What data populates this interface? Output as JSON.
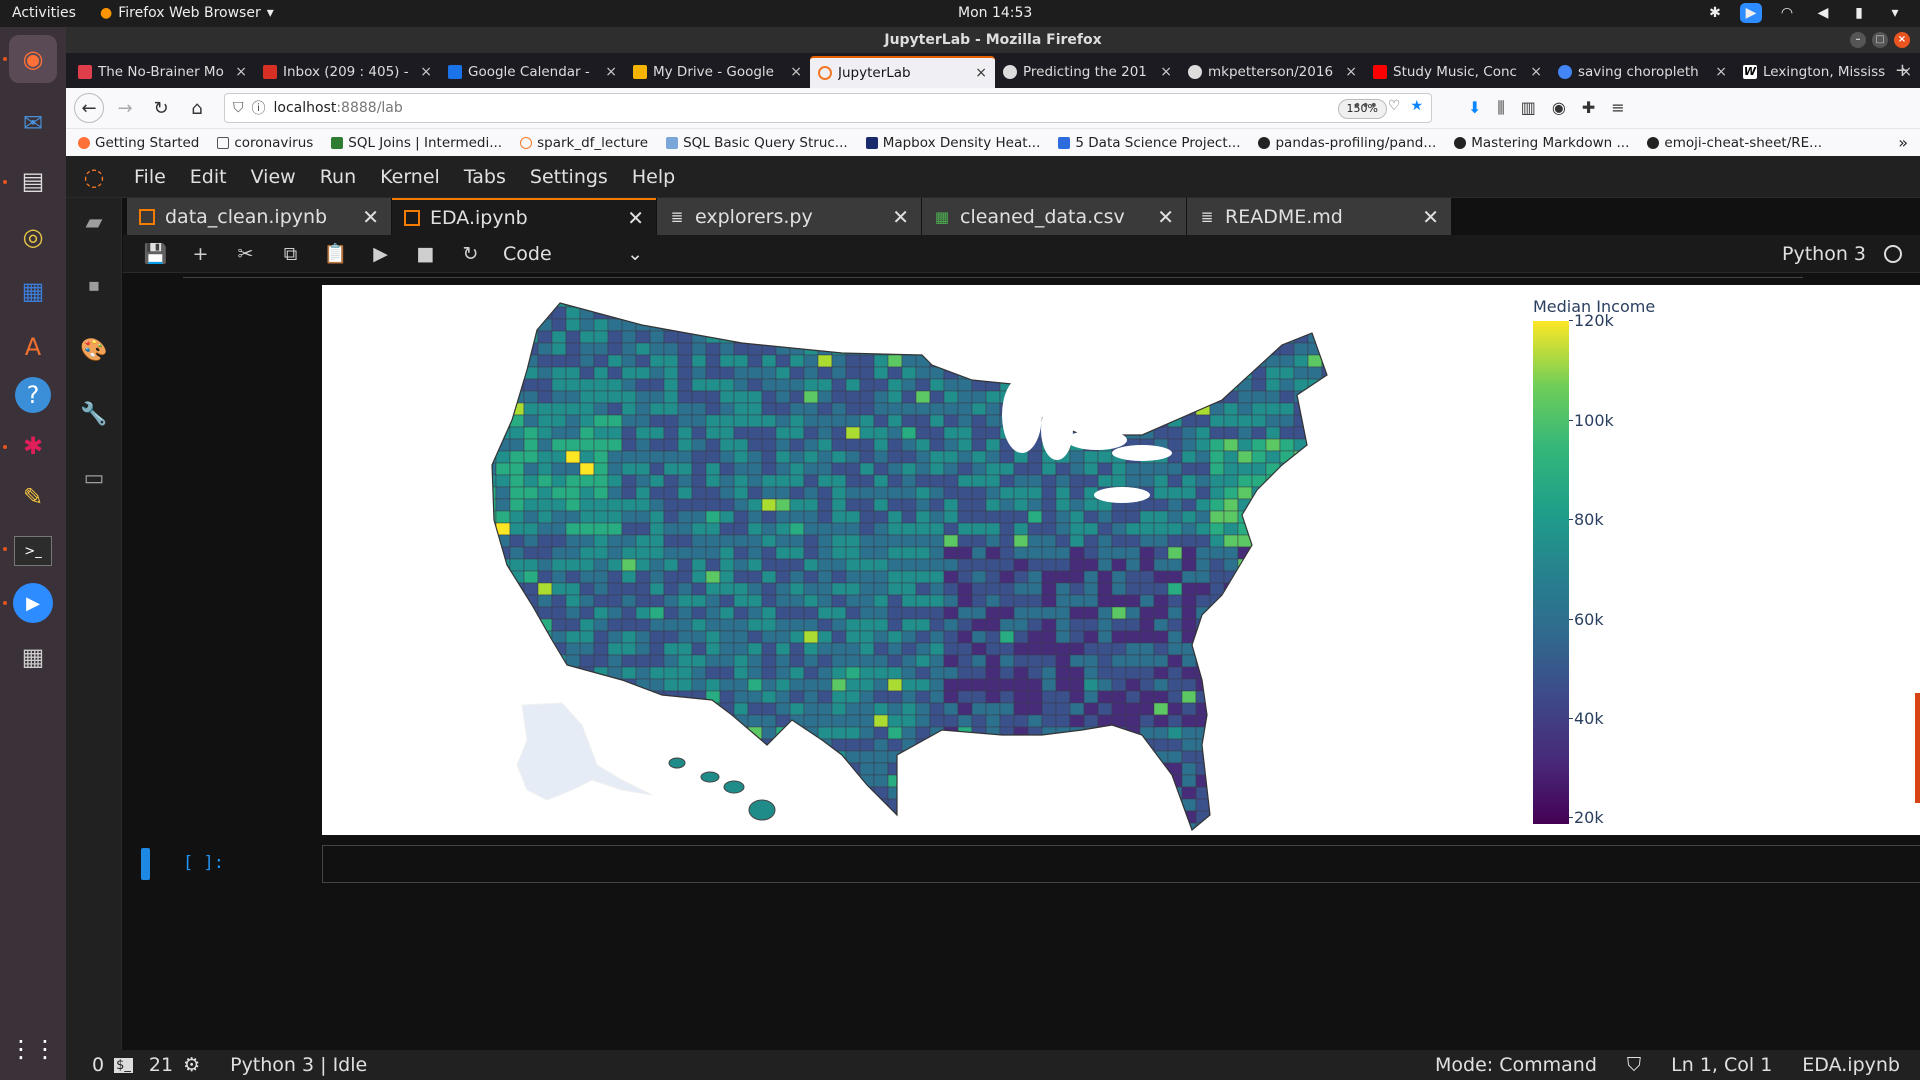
{
  "topbar": {
    "activities": "Activities",
    "app_menu": "Firefox Web Browser",
    "clock": "Mon 14:53"
  },
  "window": {
    "title": "JupyterLab - Mozilla Firefox"
  },
  "browser_tabs": [
    {
      "label": "The No-Brainer Mo",
      "favicon_color": "#e03e4b",
      "icon": "pocket-icon"
    },
    {
      "label": "Inbox (209 : 405) -",
      "favicon_color": "#d93025",
      "icon": "gmail-icon"
    },
    {
      "label": "Google Calendar -",
      "favicon_color": "#1a73e8",
      "icon": "calendar-icon"
    },
    {
      "label": "My Drive - Google",
      "favicon_color": "#f4b400",
      "icon": "drive-icon"
    },
    {
      "label": "JupyterLab",
      "favicon_color": "#f37726",
      "icon": "jupyter-icon",
      "active": true
    },
    {
      "label": "Predicting the 201",
      "favicon_color": "#333333",
      "icon": "github-icon"
    },
    {
      "label": "mkpetterson/2016",
      "favicon_color": "#333333",
      "icon": "github-icon"
    },
    {
      "label": "Study Music, Conc",
      "favicon_color": "#ff0000",
      "icon": "youtube-icon"
    },
    {
      "label": "saving choropleth",
      "favicon_color": "#4285f4",
      "icon": "google-icon"
    },
    {
      "label": "Lexington, Mississ",
      "favicon_color": "#ffffff",
      "icon": "wikipedia-icon"
    }
  ],
  "url": {
    "host": "localhost",
    "rest": ":8888/lab",
    "zoom": "150%"
  },
  "bookmarks": [
    "Getting Started",
    "coronavirus",
    "SQL Joins | Intermedi...",
    "spark_df_lecture",
    "SQL Basic Query Struc...",
    "Mapbox Density Heat...",
    "5 Data Science Project...",
    "pandas-profiling/pand...",
    "Mastering Markdown ...",
    "emoji-cheat-sheet/RE..."
  ],
  "jupyter": {
    "menu": [
      "File",
      "Edit",
      "View",
      "Run",
      "Kernel",
      "Tabs",
      "Settings",
      "Help"
    ],
    "tabs": [
      {
        "label": "data_clean.ipynb",
        "type": "notebook"
      },
      {
        "label": "EDA.ipynb",
        "type": "notebook",
        "active": true
      },
      {
        "label": "explorers.py",
        "type": "file"
      },
      {
        "label": "cleaned_data.csv",
        "type": "csv"
      },
      {
        "label": "README.md",
        "type": "file"
      }
    ],
    "cell_type": "Code",
    "kernel_name": "Python 3",
    "prompt": "[ ]:",
    "status": {
      "terminals": "0",
      "kernels": "21",
      "kernel_state": "Python 3 | Idle",
      "mode": "Mode: Command",
      "position": "Ln 1, Col 1",
      "file": "EDA.ipynb"
    }
  },
  "chart_data": {
    "type": "choropleth",
    "title": "",
    "colorbar_title": "Median Income",
    "colorscale": "viridis",
    "range": [
      20000,
      120000
    ],
    "ticks": [
      "120k",
      "100k",
      "80k",
      "60k",
      "40k",
      "20k"
    ],
    "tick_values": [
      120000,
      100000,
      80000,
      60000,
      40000,
      20000
    ],
    "regions_shown": "US counties (Alaska blank)",
    "colors": {
      "low": "#440154",
      "mid": "#21918c",
      "high": "#fde725",
      "missing": "#e5ecf6"
    }
  }
}
